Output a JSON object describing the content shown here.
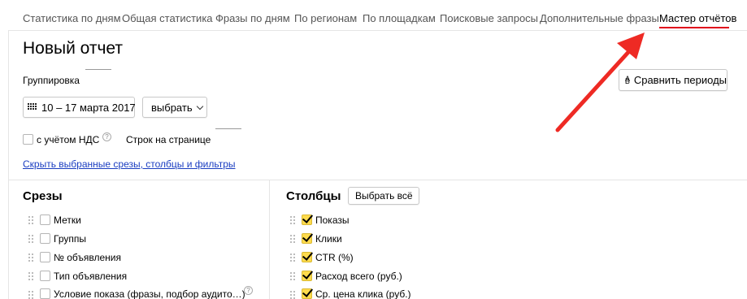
{
  "tabs": [
    "Статистика по дням",
    "Общая статистика",
    "Фразы по дням",
    "По регионам",
    "По площадкам",
    "Поисковые запросы",
    "Дополнительные фразы",
    "Мастер отчётов"
  ],
  "active_tab": "Мастер отчётов",
  "report": {
    "title": "Новый отчет",
    "grouping_label": "Группировка",
    "compare_button": "Сравнить периоды",
    "compare_icon_a": "A",
    "compare_icon_b": "B",
    "date_range": "10 – 17 марта 2017",
    "choose_button": "выбрать",
    "vat_label": "с учётом НДС",
    "vat_help": "?",
    "rows_per_page_label": "Строк на странице",
    "hide_link": "Скрыть выбранные срезы, столбцы и фильтры"
  },
  "slices": {
    "title": "Срезы",
    "items": [
      {
        "label": "Метки",
        "checked": false,
        "help": ""
      },
      {
        "label": "Группы",
        "checked": false,
        "help": ""
      },
      {
        "label": "№ объявления",
        "checked": false,
        "help": ""
      },
      {
        "label": "Тип объявления",
        "checked": false,
        "help": ""
      },
      {
        "label": "Условие показа (фразы, подбор аудито…)",
        "checked": false,
        "help": "?"
      }
    ]
  },
  "columns": {
    "title": "Столбцы",
    "select_all_button": "Выбрать всё",
    "items": [
      {
        "label": "Показы",
        "checked": true
      },
      {
        "label": "Клики",
        "checked": true
      },
      {
        "label": "CTR (%)",
        "checked": true
      },
      {
        "label": "Расход всего (руб.)",
        "checked": true
      },
      {
        "label": "Ср. цена клика (руб.)",
        "checked": true
      }
    ]
  },
  "colors": {
    "active_tab_underline": "#e0001b",
    "checkbox_checked": "#ffdb4d",
    "link": "#1a3dc1"
  },
  "icons": [
    "calendar-icon",
    "compare-periods-icon",
    "chevron-down-icon",
    "help-icon",
    "drag-handle-icon"
  ]
}
